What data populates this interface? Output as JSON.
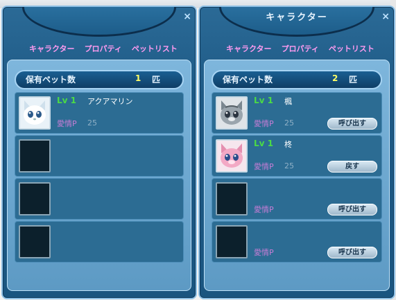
{
  "left": {
    "tabs": [
      "キャラクター",
      "プロパティ",
      "ペットリスト"
    ],
    "count_label": "保有ペット数",
    "count_value": "1",
    "count_unit": "匹",
    "slots": [
      {
        "lv": "Lv 1",
        "name": "アクアマリン",
        "aff_label": "愛情P",
        "aff_val": "25",
        "pet": "white",
        "button": ""
      },
      {
        "lv": "",
        "name": "",
        "aff_label": "",
        "aff_val": "",
        "pet": "",
        "button": ""
      },
      {
        "lv": "",
        "name": "",
        "aff_label": "",
        "aff_val": "",
        "pet": "",
        "button": ""
      },
      {
        "lv": "",
        "name": "",
        "aff_label": "",
        "aff_val": "",
        "pet": "",
        "button": ""
      }
    ]
  },
  "right": {
    "title": "キャラクター",
    "tabs": [
      "キャラクター",
      "プロパティ",
      "ペットリスト"
    ],
    "count_label": "保有ペット数",
    "count_value": "2",
    "count_unit": "匹",
    "slots": [
      {
        "lv": "Lv 1",
        "name": "楓",
        "aff_label": "愛情P",
        "aff_val": "25",
        "pet": "gray",
        "button": "呼び出す"
      },
      {
        "lv": "Lv 1",
        "name": "柊",
        "aff_label": "愛情P",
        "aff_val": "25",
        "pet": "pink",
        "button": "戻す"
      },
      {
        "lv": "",
        "name": "",
        "aff_label": "愛情P",
        "aff_val": "",
        "pet": "",
        "button": "呼び出す"
      },
      {
        "lv": "",
        "name": "",
        "aff_label": "愛情P",
        "aff_val": "",
        "pet": "",
        "button": "呼び出す"
      }
    ]
  },
  "close_glyph": "×",
  "colors": {
    "tab": "#ff9bf0",
    "level": "#4bdb45",
    "count_value": "#ffff66",
    "affection": "#c77dd6"
  }
}
